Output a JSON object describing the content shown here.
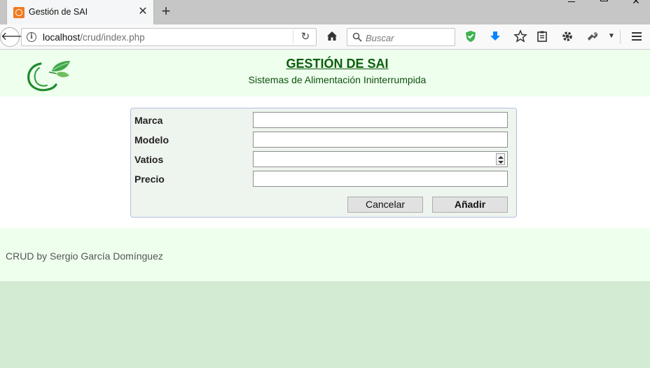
{
  "browser": {
    "tab_title": "Gestión de SAI",
    "url_host": "localhost",
    "url_path": "/crud/index.php",
    "search_placeholder": "Buscar"
  },
  "header": {
    "title": "GESTIÓN DE SAI",
    "subtitle": "Sistemas de Alimentación Ininterrumpida"
  },
  "form": {
    "fields": [
      {
        "label": "Marca",
        "value": ""
      },
      {
        "label": "Modelo",
        "value": ""
      },
      {
        "label": "Vatios",
        "value": ""
      },
      {
        "label": "Precio",
        "value": ""
      }
    ],
    "cancel_label": "Cancelar",
    "add_label": "Añadir"
  },
  "footer": {
    "text": "CRUD by Sergio García Domínguez"
  },
  "colors": {
    "header_bg": "#eeffee",
    "title_green": "#0b5e0b",
    "page_bg": "#d3ead3"
  }
}
